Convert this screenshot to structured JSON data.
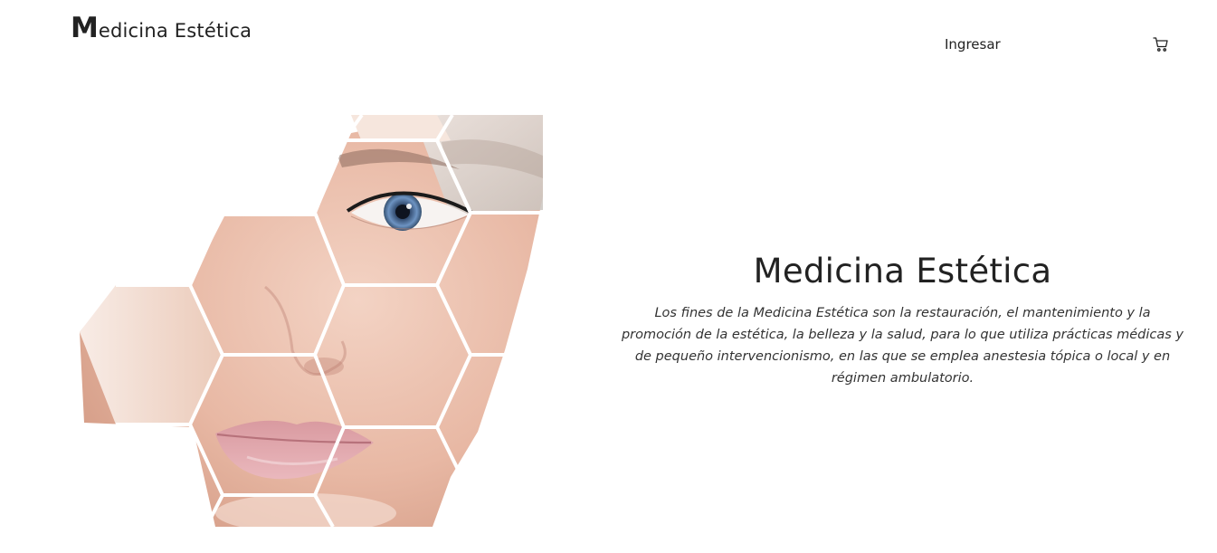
{
  "header": {
    "logo_cap": "M",
    "logo_rest": "edicina Estética",
    "nav_login": "Ingresar",
    "cart_icon": "shopping-cart-icon"
  },
  "hero": {
    "title": "Medicina Estética",
    "description": "Los fines de la Medicina Estética son la restauración, el mantenimiento y la promoción de la estética, la belleza y la salud, para lo que utiliza prácticas médicas y de pequeño intervencionismo, en las que se emplea anestesia tópica o local y en régimen ambulatorio."
  },
  "colors": {
    "background": "#ffffff",
    "text": "#222222",
    "skin": "#ecc7b6",
    "eye": "#5a7fa8"
  }
}
